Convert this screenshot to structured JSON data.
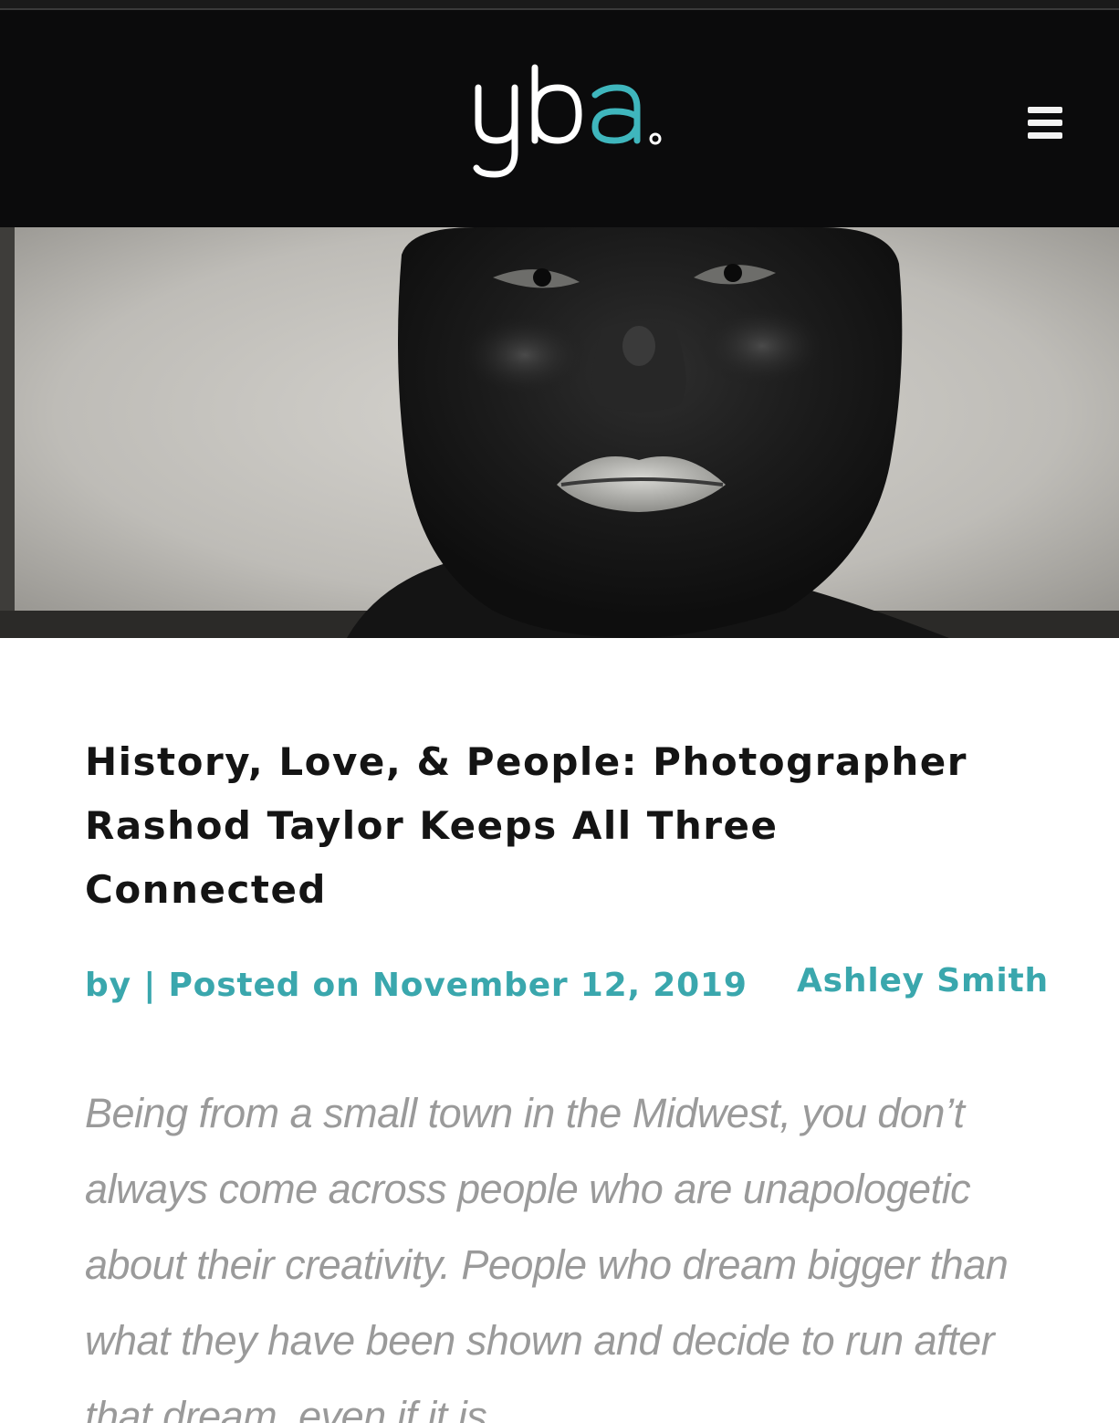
{
  "header": {
    "logo_text": "yba.",
    "logo_colors": {
      "y": "#ffffff",
      "b": "#ffffff",
      "a": "#3fb6bd",
      "dot": "#ffffff"
    },
    "menu_icon": "hamburger-icon"
  },
  "hero": {
    "alt": "black and white tintype portrait of a bearded man"
  },
  "article": {
    "title": "History, Love, & People: Photographer Rashod Taylor Keeps All Three Connected",
    "meta": {
      "by": "by",
      "separator": "|",
      "posted_on": "Posted on",
      "date": "November 12, 2019",
      "author": "Ashley Smith"
    },
    "body": "Being from a small town in the Midwest, you don’t always come across people who are unapologetic about their creativity. People who dream bigger than what they have been shown and decide to run after that dream, even if it is"
  },
  "colors": {
    "header_bg": "#0b0b0c",
    "accent": "#3aa7ad",
    "title": "#141414",
    "body_text": "#9a9a9a"
  }
}
